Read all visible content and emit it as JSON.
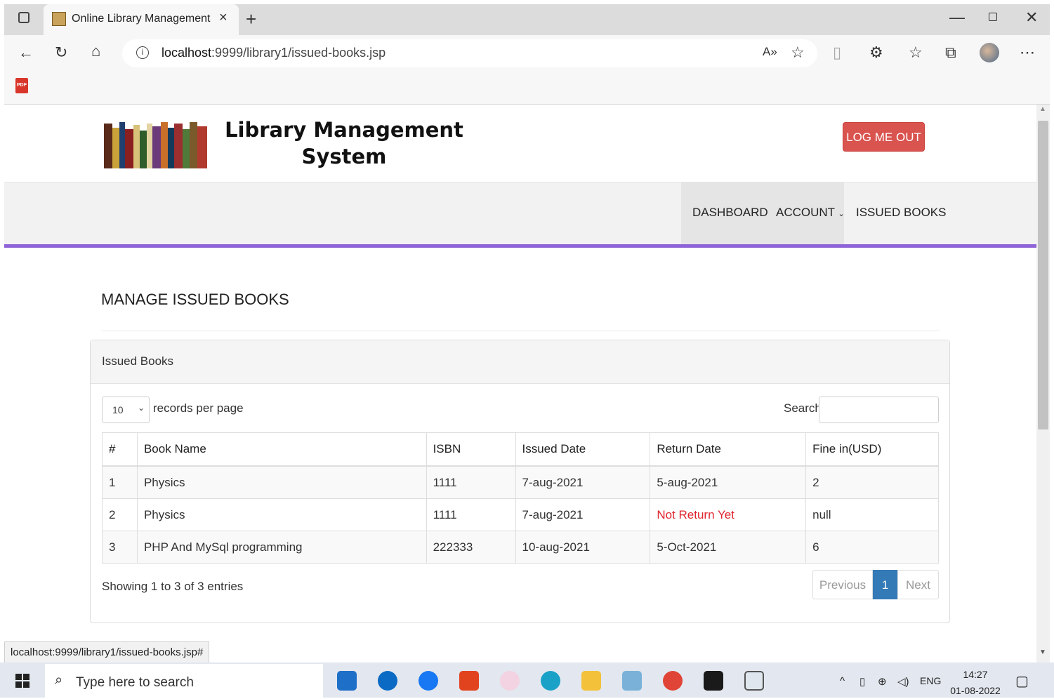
{
  "browser": {
    "tab_title": "Online Library Management Syst",
    "tab_close": "×",
    "new_tab": "+",
    "url_host": "localhost",
    "url_path": ":9999/library1/issued-books.jsp",
    "status_bar_url": "localhost:9999/library1/issued-books.jsp#"
  },
  "header": {
    "title_line1": "Library Management",
    "title_line2": "System",
    "logout_label": "LOG ME OUT",
    "logout_color": "#d9534f"
  },
  "nav": {
    "items": [
      {
        "label": "DASHBOARD"
      },
      {
        "label": "ACCOUNT"
      },
      {
        "label": "ISSUED BOOKS"
      }
    ],
    "accent_color": "#8e63d8"
  },
  "main": {
    "page_title": "MANAGE ISSUED BOOKS",
    "panel_title": "Issued Books",
    "length_value": "10",
    "length_label": "records per page",
    "search_label": "Search:",
    "search_value": "",
    "columns": [
      "#",
      "Book Name",
      "ISBN",
      "Issued Date",
      "Return Date",
      "Fine in(USD)"
    ],
    "rows": [
      [
        "1",
        "Physics",
        "1111",
        "7-aug-2021",
        "5-aug-2021",
        "2"
      ],
      [
        "2",
        "Physics",
        "1111",
        "7-aug-2021",
        "Not Return Yet",
        "null"
      ],
      [
        "3",
        "PHP And MySql programming",
        "222333",
        "10-aug-2021",
        "5-Oct-2021",
        "6"
      ]
    ],
    "info": "Showing 1 to 3 of 3 entries",
    "pager": {
      "previous": "Previous",
      "current": "1",
      "next": "Next"
    },
    "status_color_not_returned": "#e0242d"
  },
  "taskbar": {
    "search_placeholder": "Type here to search",
    "lang": "ENG",
    "time": "14:27",
    "date": "01-08-2022",
    "apps": [
      "mail-icon",
      "dell-icon",
      "facebook-icon",
      "office-icon",
      "snip-icon",
      "edge-icon",
      "file-explorer-icon",
      "notepad-icon",
      "chrome-icon",
      "terminal-icon",
      "app-window-icon"
    ]
  }
}
